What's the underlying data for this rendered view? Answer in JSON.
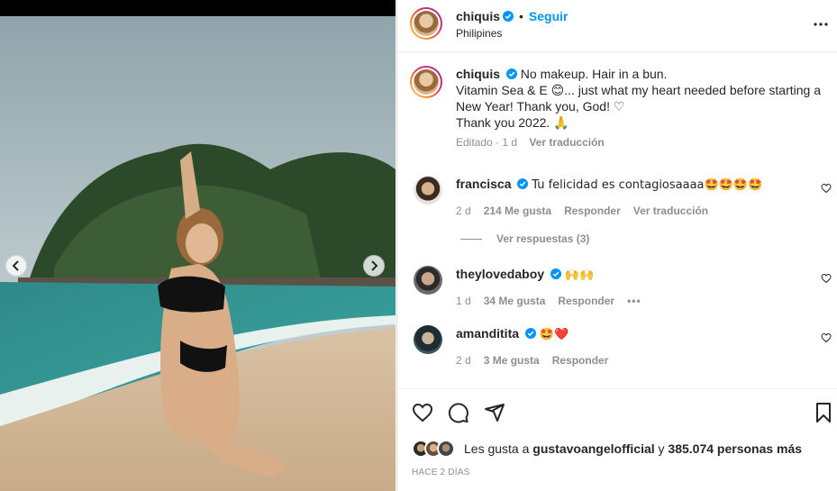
{
  "post": {
    "username": "chiquis",
    "follow_label": "Seguir",
    "separator": "•",
    "location": "Philipines"
  },
  "caption": {
    "username": "chiquis",
    "line1": "No makeup. Hair in a bun.",
    "line2": "Vitamin Sea & E 😊... just what my heart needed before starting a New Year! Thank you, God! ♡",
    "line3": "Thank you 2022. 🙏",
    "edited": "Editado · 1 d",
    "translate": "Ver traducción"
  },
  "comments": [
    {
      "username": "francisca",
      "text": "Tu felicidad es contagiosaaaa🤩🤩🤩🤩",
      "time": "2 d",
      "likes": "214 Me gusta",
      "reply": "Responder",
      "translate": "Ver traducción"
    },
    {
      "username": "theylovedaboy",
      "text": "🙌🙌",
      "time": "1 d",
      "likes": "34 Me gusta",
      "reply": "Responder",
      "more": "•••"
    },
    {
      "username": "amanditita",
      "text": "🤩❤️",
      "time": "2 d",
      "likes": "3 Me gusta",
      "reply": "Responder"
    }
  ],
  "view_replies": "Ver respuestas (3)",
  "likes": {
    "prefix": "Les gusta a",
    "user": "gustavoangelofficial",
    "and": "y",
    "others": "385.074 personas más"
  },
  "timestamp": "Hace 2 días",
  "icons": {
    "like": "heart-icon",
    "comment": "comment-icon",
    "share": "share-icon",
    "save": "bookmark-icon",
    "more": "more-icon",
    "verified": "verified-badge-icon"
  },
  "colors": {
    "accent": "#0095f6",
    "verified": "#0095f6",
    "muted": "#8e8e8e",
    "text": "#262626"
  }
}
